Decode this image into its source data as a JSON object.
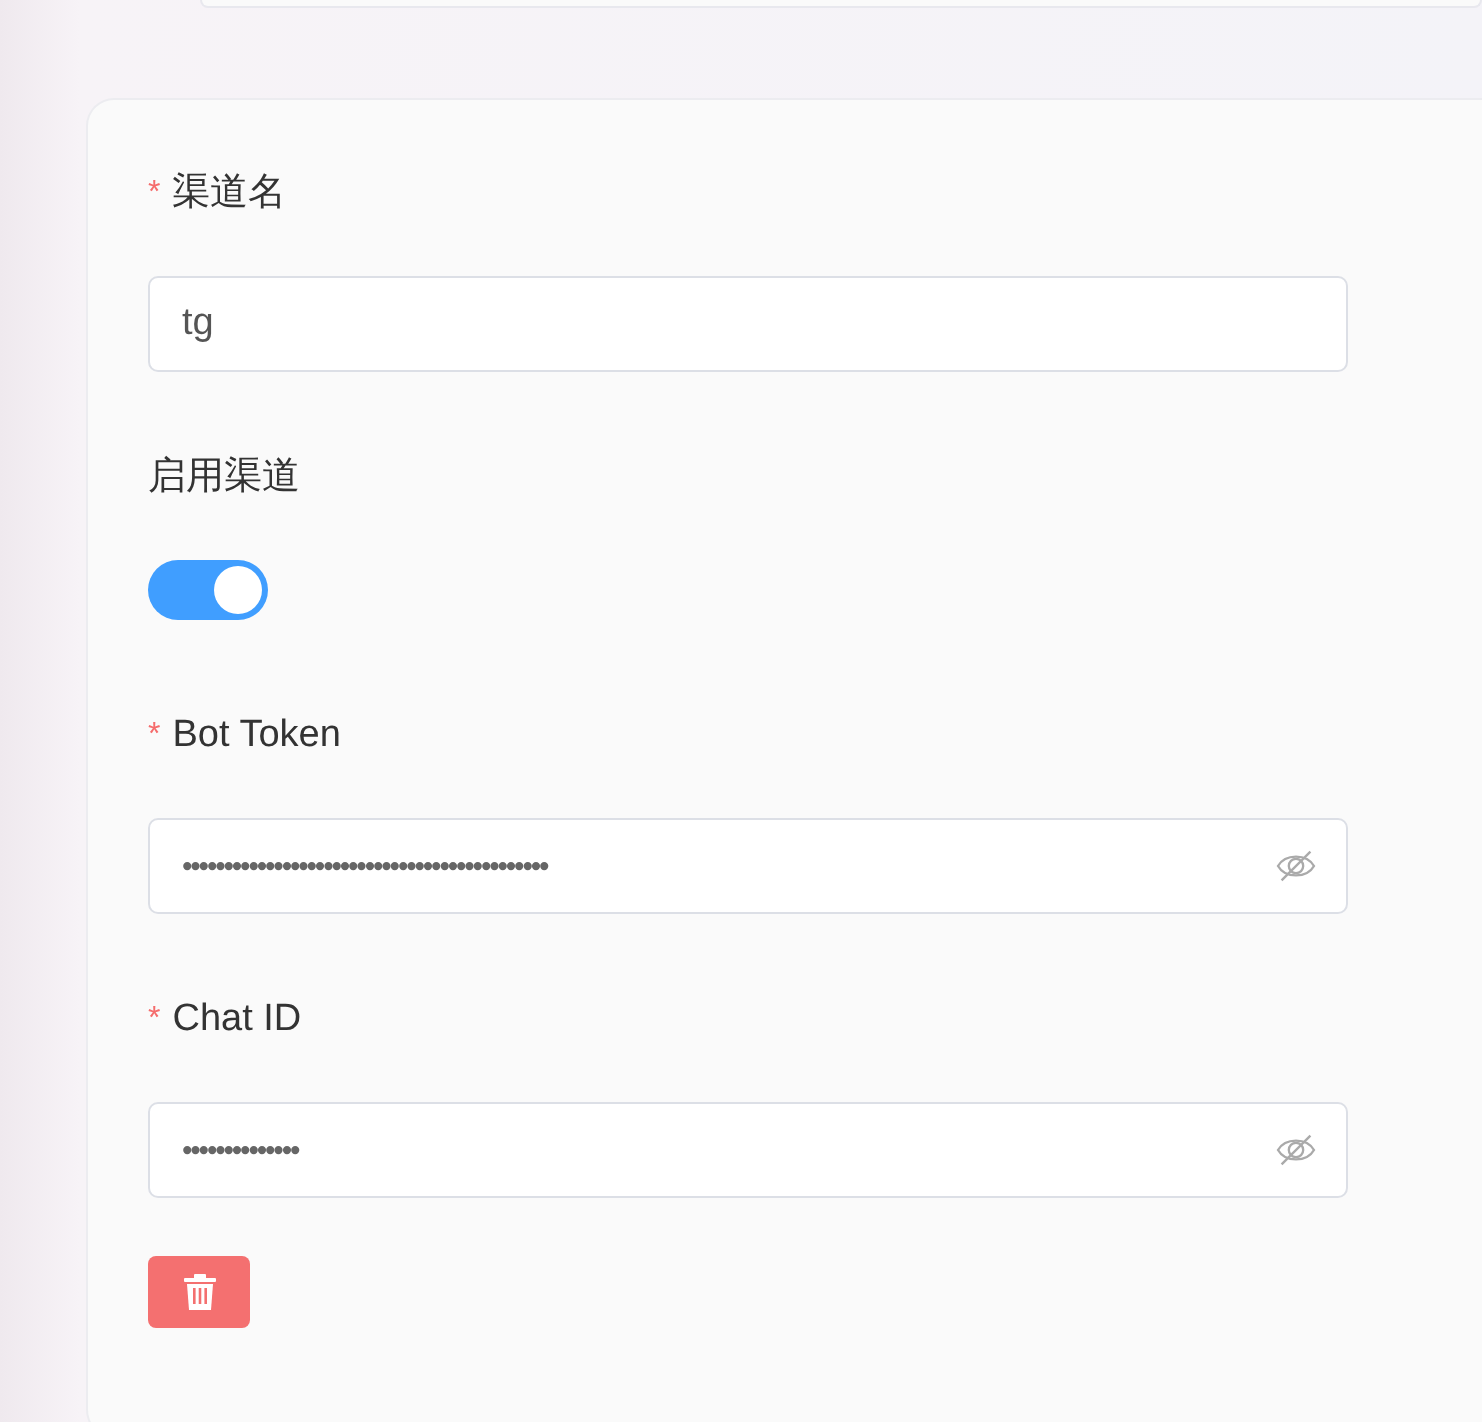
{
  "fields": [
    {
      "kind": "text",
      "required_mark": "*",
      "label": "渠道名",
      "value": "tg"
    },
    {
      "kind": "switch",
      "label": "启用渠道",
      "on": true
    },
    {
      "kind": "password",
      "required_mark": "*",
      "label": "Bot Token",
      "value": "••••••••••••••••••••••••••••••••••••••••••••"
    },
    {
      "kind": "password",
      "required_mark": "*",
      "label": "Chat ID",
      "value": "••••••••••••••"
    }
  ],
  "delete_button": {
    "kind": "danger"
  }
}
